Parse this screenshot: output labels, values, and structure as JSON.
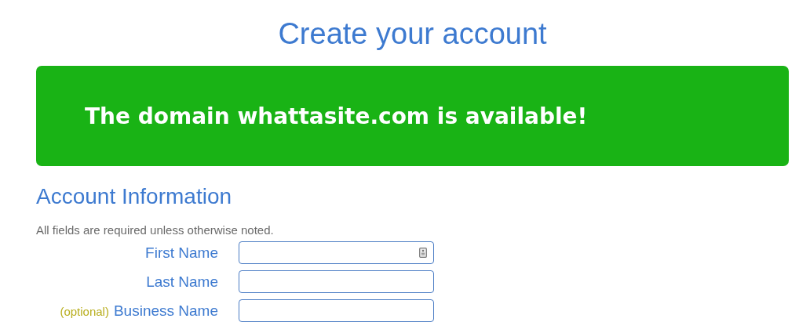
{
  "page_title": "Create your account",
  "banner": {
    "message": "The domain whattasite.com is available!"
  },
  "section": {
    "heading": "Account Information",
    "note": "All fields are required unless otherwise noted.",
    "fields": [
      {
        "label": "First Name",
        "autofill_icon": true
      },
      {
        "label": "Last Name",
        "autofill_icon": false
      },
      {
        "label": "Business Name",
        "optional_text": "(optional)",
        "autofill_icon": false
      }
    ]
  }
}
